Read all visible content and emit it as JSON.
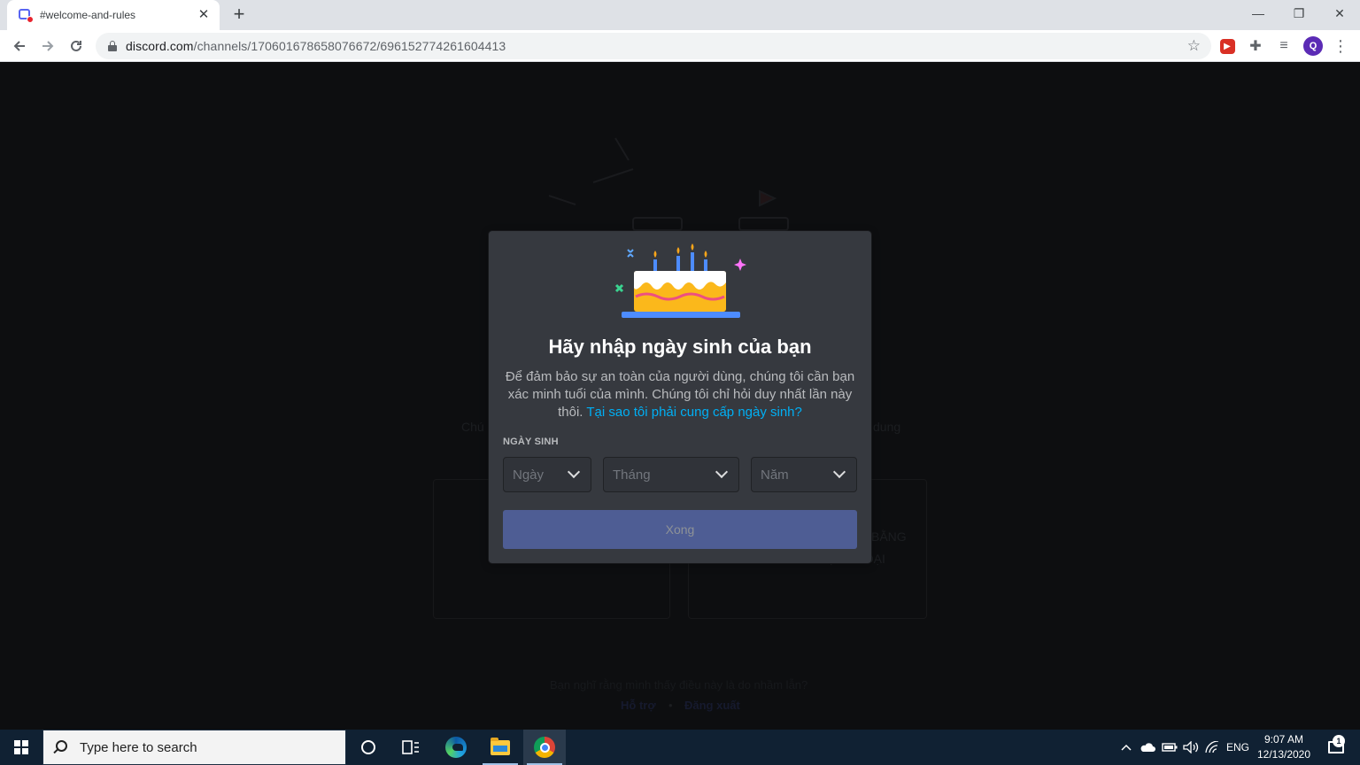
{
  "browser": {
    "tab": {
      "title": "#welcome-and-rules",
      "close_glyph": "✕"
    },
    "new_tab_glyph": "+",
    "window_controls": {
      "minimize": "—",
      "restore": "❐",
      "close": "✕"
    },
    "address": {
      "host": "discord.com",
      "path": "/channels/170601678658076672/696152774261604413"
    },
    "profile_initial": "Q"
  },
  "background_page": {
    "faded_left_text": "Chú",
    "faded_right_text": "dung",
    "faded_card_line1": "BẰNG",
    "faded_card_line2": "ĐIỆN THOẠI",
    "faded_footer_question": "Bạn nghĩ rằng mình thấy điều này là do nhầm lẫn?",
    "faded_footer_help": "Hỗ trợ",
    "faded_footer_sep": "•",
    "faded_footer_logout": "Đăng xuất"
  },
  "modal": {
    "title": "Hãy nhập ngày sinh của bạn",
    "description": "Để đảm bảo sự an toàn của người dùng, chúng tôi cần bạn xác minh tuổi của mình. Chúng tôi chỉ hỏi duy nhất lần này thôi.",
    "why_link": "Tại sao tôi phải cung cấp ngày sinh?",
    "dob_label": "NGÀY SINH",
    "day_placeholder": "Ngày",
    "month_placeholder": "Tháng",
    "year_placeholder": "Năm",
    "done_button": "Xong",
    "colors": {
      "background": "#36393f",
      "button": "#4e5d94",
      "link": "#00aff4"
    }
  },
  "taskbar": {
    "search_placeholder": "Type here to search",
    "language": "ENG",
    "time": "9:07 AM",
    "date": "12/13/2020",
    "notification_count": "1"
  }
}
